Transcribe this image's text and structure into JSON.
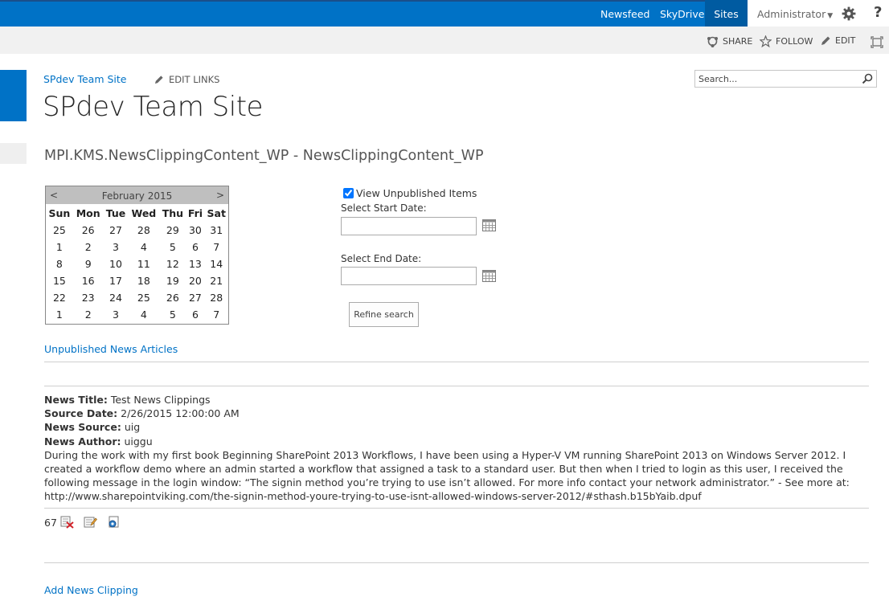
{
  "suite_bar": {
    "links": [
      "Newsfeed",
      "SkyDrive",
      "Sites"
    ],
    "user": "Administrator",
    "help": "?"
  },
  "ribbon": {
    "share": "SHARE",
    "follow": "FOLLOW",
    "edit": "EDIT"
  },
  "header": {
    "breadcrumb": "SPdev Team Site",
    "edit_links": "EDIT LINKS",
    "site_title": "SPdev Team Site",
    "search_placeholder": "Search..."
  },
  "page_heading": "MPI.KMS.NewsClippingContent_WP - NewsClippingContent_WP",
  "calendar": {
    "prev": "<",
    "next": ">",
    "month": "February 2015",
    "day_names": [
      "Sun",
      "Mon",
      "Tue",
      "Wed",
      "Thu",
      "Fri",
      "Sat"
    ],
    "weeks": [
      [
        "25",
        "26",
        "27",
        "28",
        "29",
        "30",
        "31"
      ],
      [
        "1",
        "2",
        "3",
        "4",
        "5",
        "6",
        "7"
      ],
      [
        "8",
        "9",
        "10",
        "11",
        "12",
        "13",
        "14"
      ],
      [
        "15",
        "16",
        "17",
        "18",
        "19",
        "20",
        "21"
      ],
      [
        "22",
        "23",
        "24",
        "25",
        "26",
        "27",
        "28"
      ],
      [
        "1",
        "2",
        "3",
        "4",
        "5",
        "6",
        "7"
      ]
    ]
  },
  "filters": {
    "view_unpublished_label": "View Unpublished Items",
    "view_unpublished_checked": true,
    "start_date_label": "Select Start Date:",
    "start_date_value": "",
    "end_date_label": "Select End Date:",
    "end_date_value": "",
    "refine_button": "Refine search"
  },
  "section_link": "Unpublished News Articles",
  "article": {
    "title_label": "News Title:",
    "title": "Test News Clippings",
    "date_label": "Source Date:",
    "date": "2/26/2015 12:00:00 AM",
    "source_label": "News Source:",
    "source": "uig",
    "author_label": "News Author:",
    "author": "uiggu",
    "body": "During the work with my first book Beginning SharePoint 2013 Workflows, I have been using a Hyper-V VM running SharePoint 2013 on Windows Server 2012. I created a workflow demo where an admin started a workflow that assigned a task to a standard user. But then when I tried to login as this user, I received the following message in the login window: “The signin method you’re trying to use isn’t allowed. For more info contact your network administrator.” - See more at: http://www.sharepointviking.com/the-signin-method-youre-trying-to-use-isnt-allowed-windows-server-2012/#sthash.b15bYaib.dpuf",
    "item_id": "67",
    "icons": [
      "delete-icon",
      "edit-icon",
      "view-icon"
    ]
  },
  "add_link": "Add News Clipping",
  "colors": {
    "suite_blue": "#0072c6",
    "link_blue": "#0072c6",
    "ribbon_gray": "#f1f1f1",
    "calendar_header": "#bfbfbf"
  }
}
